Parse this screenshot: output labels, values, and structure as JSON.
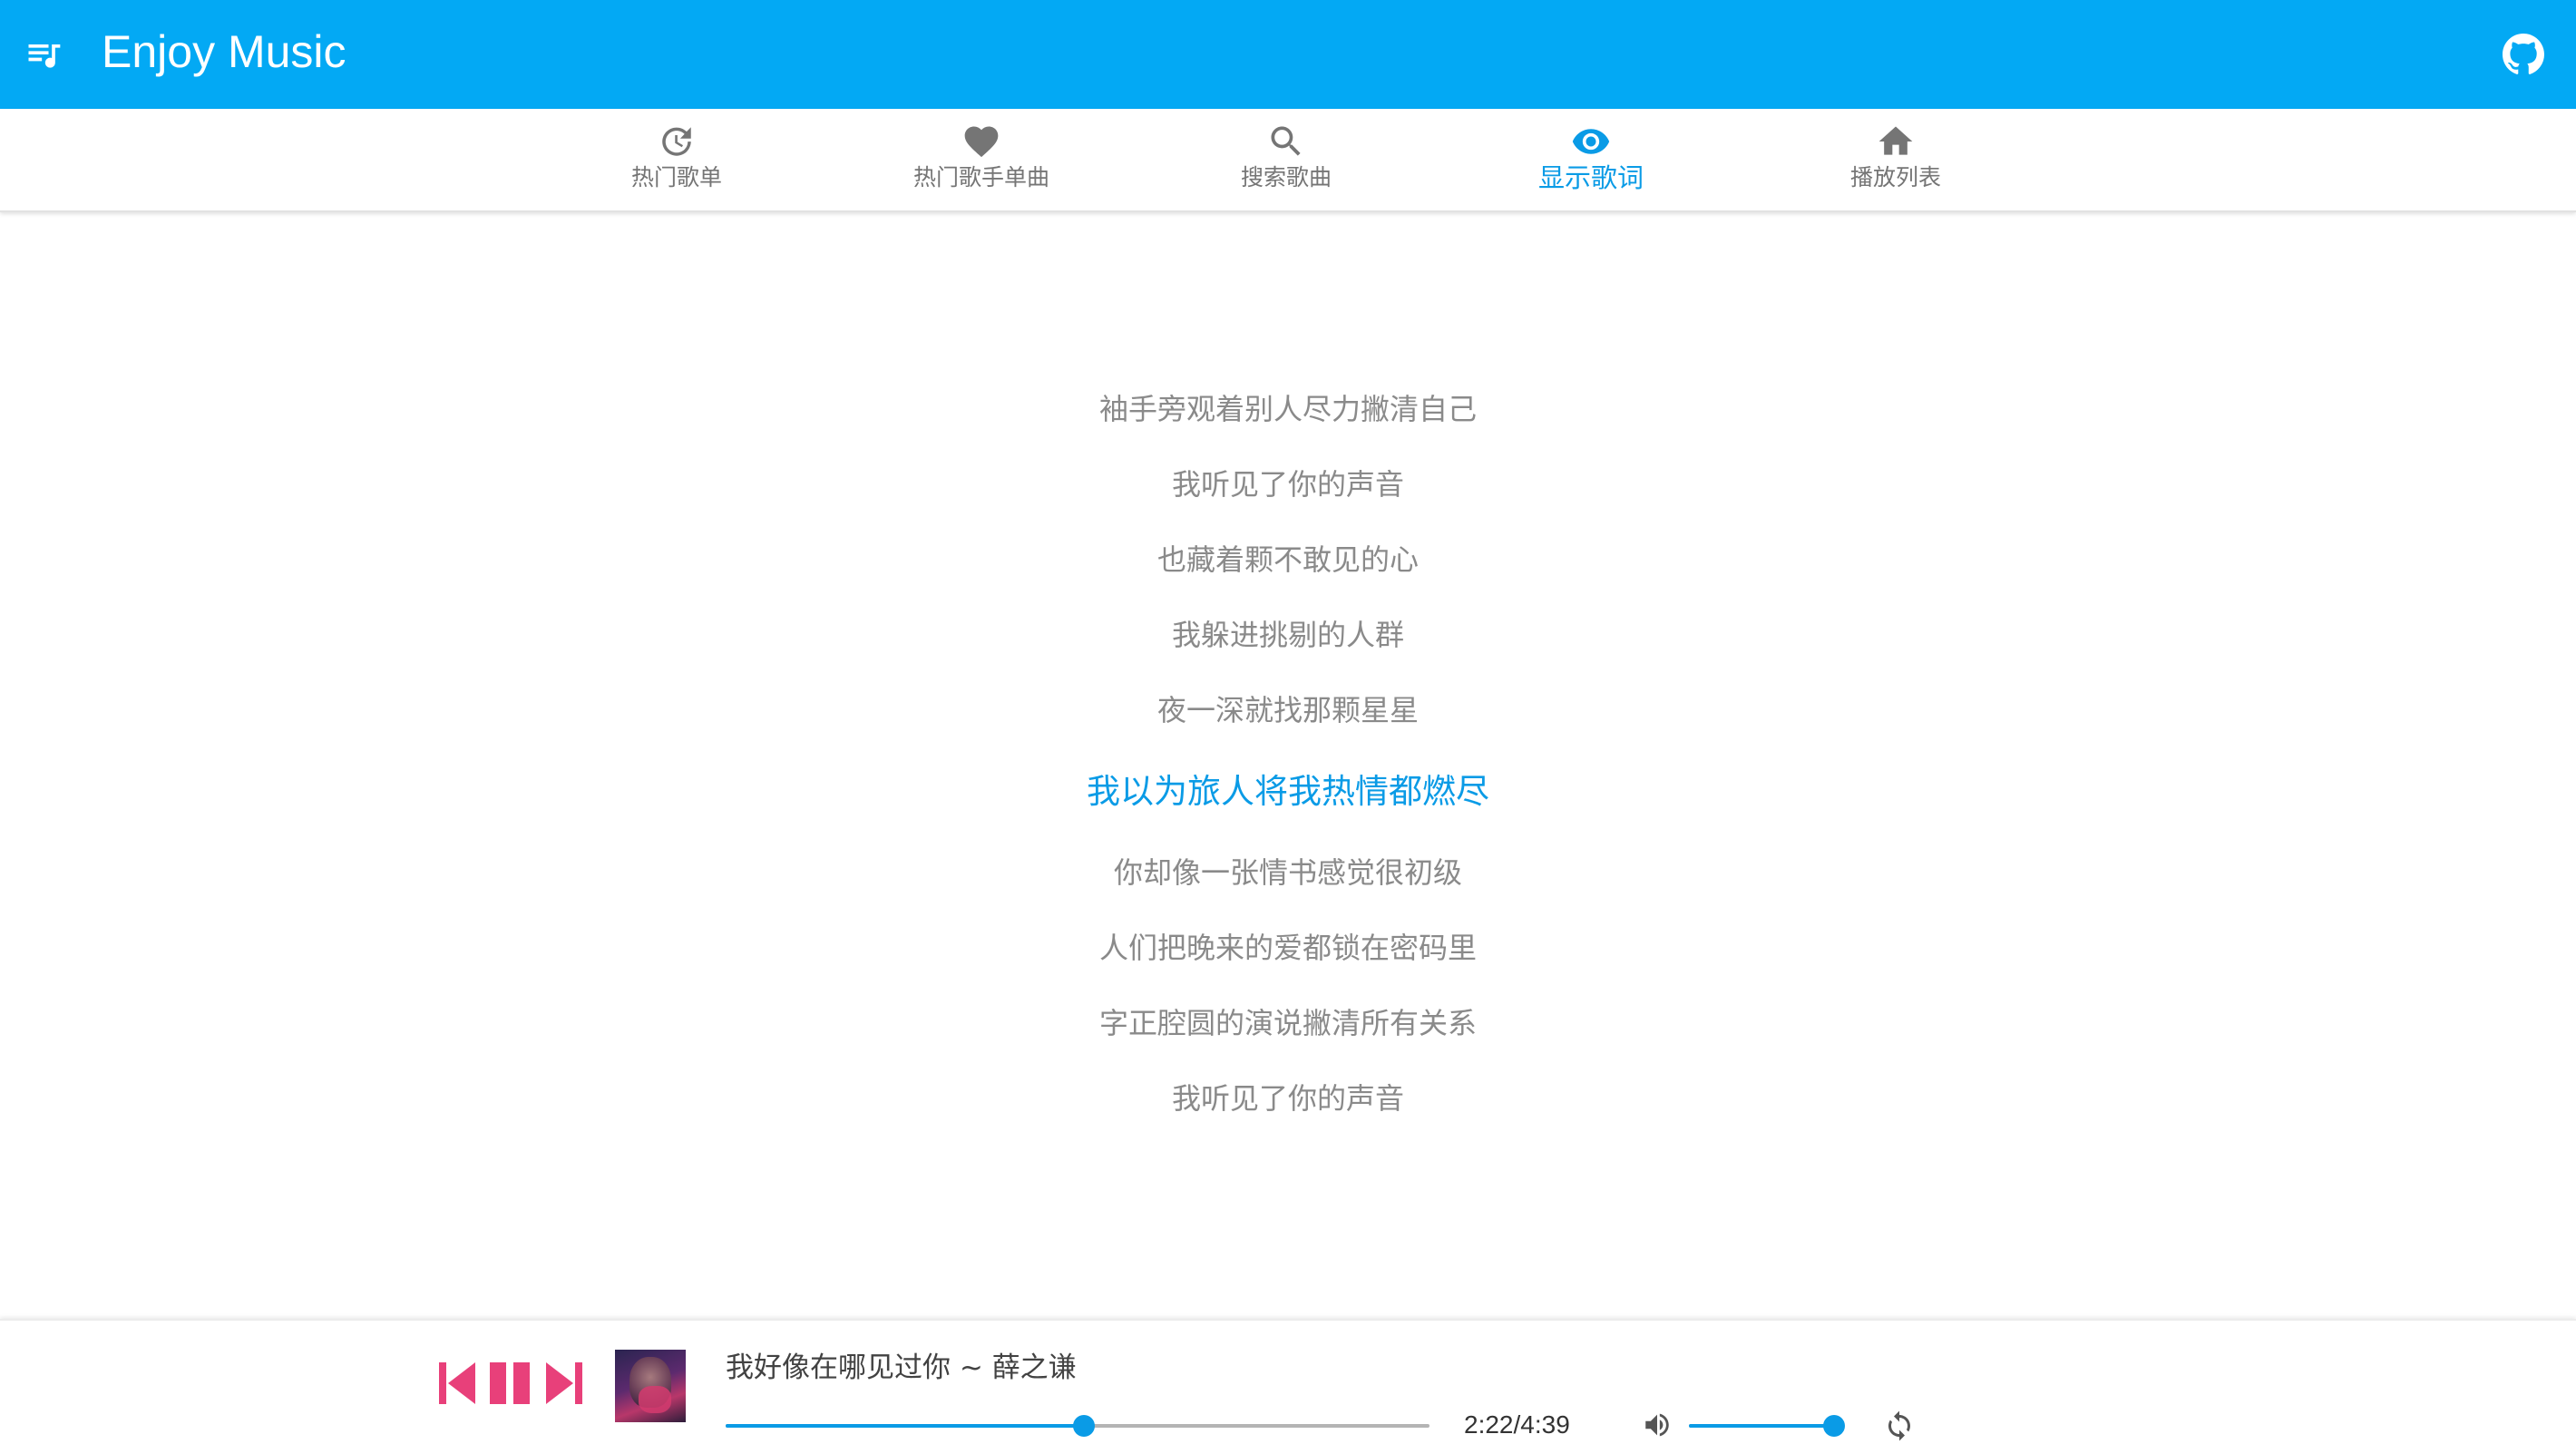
{
  "app": {
    "title": "Enjoy Music",
    "accent_color": "#03a9f4",
    "highlight_color": "#0a9be6",
    "control_color": "#e8407a"
  },
  "header": {
    "menu_icon": "queue-music-icon",
    "github_icon": "github-icon"
  },
  "tabs": [
    {
      "label": "热门歌单",
      "icon": "history-icon",
      "active": false
    },
    {
      "label": "热门歌手单曲",
      "icon": "heart-icon",
      "active": false
    },
    {
      "label": "搜索歌曲",
      "icon": "search-icon",
      "active": false
    },
    {
      "label": "显示歌词",
      "icon": "eye-icon",
      "active": true
    },
    {
      "label": "播放列表",
      "icon": "home-icon",
      "active": false
    }
  ],
  "lyrics": {
    "lines": [
      "袖手旁观着别人尽力撇清自己",
      "我听见了你的声音",
      "也藏着颗不敢见的心",
      "我躲进挑剔的人群",
      "夜一深就找那颗星星",
      "我以为旅人将我热情都燃尽",
      "你却像一张情书感觉很初级",
      "人们把晚来的爱都锁在密码里",
      "字正腔圆的演说撇清所有关系",
      "我听见了你的声音"
    ],
    "current_index": 5
  },
  "player": {
    "song": "我好像在哪见过你 ~ 薛之谦",
    "time": "2:22/4:39",
    "progress": 0.509,
    "volume": 1.0,
    "icons": {
      "previous": "skip-previous-icon",
      "pause": "pause-icon",
      "next": "skip-next-icon",
      "volume": "volume-icon",
      "loop": "loop-icon"
    }
  }
}
